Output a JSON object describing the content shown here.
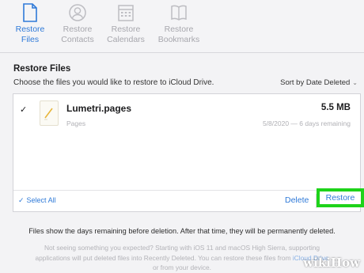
{
  "tabs": [
    {
      "line1": "Restore",
      "line2": "Files",
      "icon": "file-icon",
      "active": true
    },
    {
      "line1": "Restore",
      "line2": "Contacts",
      "icon": "contacts-icon",
      "active": false
    },
    {
      "line1": "Restore",
      "line2": "Calendars",
      "icon": "calendar-icon",
      "active": false
    },
    {
      "line1": "Restore",
      "line2": "Bookmarks",
      "icon": "book-icon",
      "active": false
    }
  ],
  "panel": {
    "title": "Restore Files",
    "subtitle": "Choose the files you would like to restore to iCloud Drive.",
    "sort_label": "Sort by Date Deleted"
  },
  "files": [
    {
      "name": "Lumetri.pages",
      "kind": "Pages",
      "size": "5.5 MB",
      "date": "5/8/2020 — 6 days remaining",
      "checked": true
    }
  ],
  "footer": {
    "select_all": "Select All",
    "delete": "Delete",
    "restore": "Restore"
  },
  "info_text": "Files show the days remaining before deletion. After that time, they will be permanently deleted.",
  "fine_print": {
    "before": "Not seeing something you expected? Starting with iOS 11 and macOS High Sierra, supporting applications will put deleted files into Recently Deleted. You can restore these files from ",
    "link": "iCloud Drive",
    "after": " or from your device."
  },
  "watermark": "wikiHow",
  "colors": {
    "accent": "#2f7ad8",
    "highlight": "#1ed31a"
  }
}
